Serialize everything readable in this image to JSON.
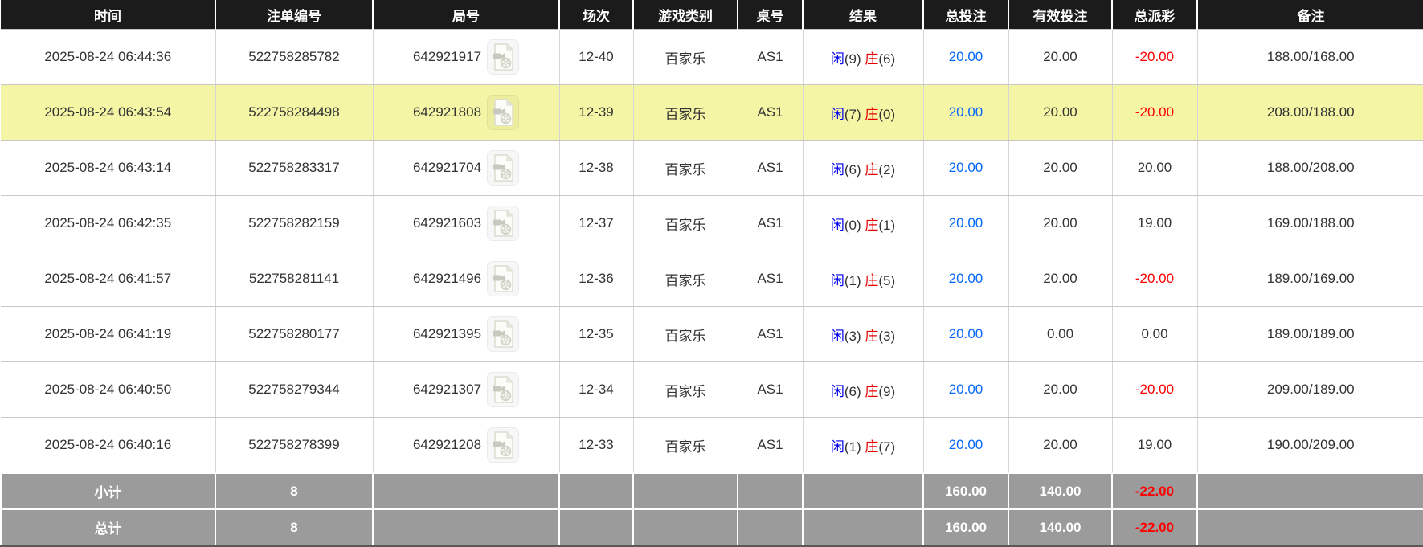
{
  "table": {
    "columns": [
      {
        "id": "time",
        "label": "时间"
      },
      {
        "id": "bet_id",
        "label": "注单编号"
      },
      {
        "id": "round_id",
        "label": "局号"
      },
      {
        "id": "session",
        "label": "场次"
      },
      {
        "id": "game_type",
        "label": "游戏类别"
      },
      {
        "id": "table_id",
        "label": "桌号"
      },
      {
        "id": "result",
        "label": "结果"
      },
      {
        "id": "total_bet",
        "label": "总投注"
      },
      {
        "id": "valid_bet",
        "label": "有效投注"
      },
      {
        "id": "payout",
        "label": "总派彩"
      },
      {
        "id": "remark",
        "label": "备注"
      }
    ]
  },
  "rows": [
    {
      "time": "2025-08-24 06:44:36",
      "bet_id": "522758285782",
      "round_id": "642921917",
      "session": "12-40",
      "game_type": "百家乐",
      "table_id": "AS1",
      "result_player_label": "闲",
      "result_player_value": "(9)",
      "result_banker_label": "庄",
      "result_banker_value": "(6)",
      "total_bet": "20.00",
      "valid_bet": "20.00",
      "payout": "-20.00",
      "remark": "188.00/168.00",
      "highlighted": false
    },
    {
      "time": "2025-08-24 06:43:54",
      "bet_id": "522758284498",
      "round_id": "642921808",
      "session": "12-39",
      "game_type": "百家乐",
      "table_id": "AS1",
      "result_player_label": "闲",
      "result_player_value": "(7)",
      "result_banker_label": "庄",
      "result_banker_value": "(0)",
      "total_bet": "20.00",
      "valid_bet": "20.00",
      "payout": "-20.00",
      "remark": "208.00/188.00",
      "highlighted": true
    },
    {
      "time": "2025-08-24 06:43:14",
      "bet_id": "522758283317",
      "round_id": "642921704",
      "session": "12-38",
      "game_type": "百家乐",
      "table_id": "AS1",
      "result_player_label": "闲",
      "result_player_value": "(6)",
      "result_banker_label": "庄",
      "result_banker_value": "(2)",
      "total_bet": "20.00",
      "valid_bet": "20.00",
      "payout": "20.00",
      "remark": "188.00/208.00",
      "highlighted": false
    },
    {
      "time": "2025-08-24 06:42:35",
      "bet_id": "522758282159",
      "round_id": "642921603",
      "session": "12-37",
      "game_type": "百家乐",
      "table_id": "AS1",
      "result_player_label": "闲",
      "result_player_value": "(0)",
      "result_banker_label": "庄",
      "result_banker_value": "(1)",
      "total_bet": "20.00",
      "valid_bet": "20.00",
      "payout": "19.00",
      "remark": "169.00/188.00",
      "highlighted": false
    },
    {
      "time": "2025-08-24 06:41:57",
      "bet_id": "522758281141",
      "round_id": "642921496",
      "session": "12-36",
      "game_type": "百家乐",
      "table_id": "AS1",
      "result_player_label": "闲",
      "result_player_value": "(1)",
      "result_banker_label": "庄",
      "result_banker_value": "(5)",
      "total_bet": "20.00",
      "valid_bet": "20.00",
      "payout": "-20.00",
      "remark": "189.00/169.00",
      "highlighted": false
    },
    {
      "time": "2025-08-24 06:41:19",
      "bet_id": "522758280177",
      "round_id": "642921395",
      "session": "12-35",
      "game_type": "百家乐",
      "table_id": "AS1",
      "result_player_label": "闲",
      "result_player_value": "(3)",
      "result_banker_label": "庄",
      "result_banker_value": "(3)",
      "total_bet": "20.00",
      "valid_bet": "0.00",
      "payout": "0.00",
      "remark": "189.00/189.00",
      "highlighted": false
    },
    {
      "time": "2025-08-24 06:40:50",
      "bet_id": "522758279344",
      "round_id": "642921307",
      "session": "12-34",
      "game_type": "百家乐",
      "table_id": "AS1",
      "result_player_label": "闲",
      "result_player_value": "(6)",
      "result_banker_label": "庄",
      "result_banker_value": "(9)",
      "total_bet": "20.00",
      "valid_bet": "20.00",
      "payout": "-20.00",
      "remark": "209.00/189.00",
      "highlighted": false
    },
    {
      "time": "2025-08-24 06:40:16",
      "bet_id": "522758278399",
      "round_id": "642921208",
      "session": "12-33",
      "game_type": "百家乐",
      "table_id": "AS1",
      "result_player_label": "闲",
      "result_player_value": "(1)",
      "result_banker_label": "庄",
      "result_banker_value": "(7)",
      "total_bet": "20.00",
      "valid_bet": "20.00",
      "payout": "19.00",
      "remark": "190.00/209.00",
      "highlighted": false
    }
  ],
  "footer": {
    "subtotal": {
      "label": "小计",
      "count": "8",
      "total_bet": "160.00",
      "valid_bet": "140.00",
      "payout": "-22.00"
    },
    "total": {
      "label": "总计",
      "count": "8",
      "total_bet": "160.00",
      "valid_bet": "140.00",
      "payout": "-22.00"
    }
  },
  "icons": {
    "video_replay": "video-file-icon"
  },
  "colors": {
    "header_bg": "#1b1b1b",
    "highlight_row": "#f5f5a6",
    "summary_bg": "#9b9b9b",
    "link_blue": "#0568fd",
    "player_blue": "#0000ee",
    "banker_red": "#e60000",
    "negative_red": "#ff0000"
  }
}
